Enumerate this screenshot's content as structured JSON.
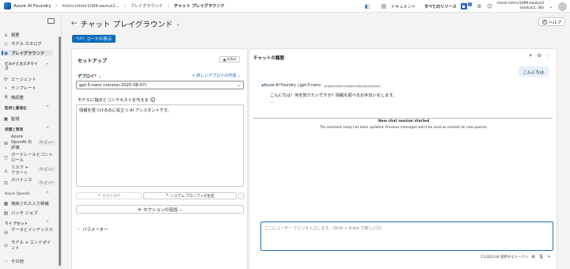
{
  "topbar": {
    "brand": "Azure AI Foundry",
    "breadcrumbs": [
      "moris-mhmr1h89-eastus2",
      "プレイグラウンド",
      "チャット プレイグラウンド"
    ],
    "docs": "ドキュメント",
    "all_resources": "すべてのリソース",
    "notif_badge": "2",
    "user_line1": "moris-mhmr1h89-eastus2",
    "user_line2": "(eastus2, 3B)"
  },
  "sidebar": {
    "items_top": [
      "概要",
      "モデル カタログ",
      "プレイグラウンド"
    ],
    "section_build": "ビルドとカスタマイズ",
    "build_items": [
      "エージェント",
      "テンプレート",
      "微調整"
    ],
    "section_observe": "監視と最適化",
    "observe_items": [
      "監視"
    ],
    "section_protect": "保護と管理",
    "protect_items": [
      {
        "label": "Azure OpenAI の評価",
        "tag": "プレビュー"
      },
      {
        "label": "ガードレールとコントロール",
        "tag": ""
      },
      {
        "label": "リスク + アラート",
        "tag": "プレビュー"
      },
      {
        "label": "ガバナンス",
        "tag": "プレビュー"
      }
    ],
    "section_aoai": "Azure OpenAI",
    "aoai_items": [
      "格納された入力候補",
      "バッチ ジョブ"
    ],
    "section_assets": "マイ アセット",
    "asset_items": [
      "データとインデックス",
      "モデル + エンドポイント"
    ],
    "more": "その他"
  },
  "main": {
    "title": "チャット プレイグラウンド",
    "help": "ヘルプ",
    "code_button": "コードの表示"
  },
  "setup": {
    "title": "セットアップ",
    "hide": "非表示",
    "deploy_label": "デプロイ",
    "new_deploy": "新しいデプロイの作成",
    "deployment": "gpt-5-nano (version:2025-08-07)",
    "instr_label": "モデルに指示とコンテキストを与える",
    "instructions": "情報を見つけるのに役立つ AI アシスタントです。",
    "apply_changes": "変更の適用",
    "gen_prompt": "システム プロンプトの生成",
    "add_section": "セクションの追加",
    "parameters": "パラメーター"
  },
  "chat": {
    "title": "チャットの履歴",
    "user_message": "こんにちは",
    "assistant_name": "Azure AI Foundry | gpt-5-nano",
    "ai_tag": "AI-generated content may be incorrect",
    "assistant_message": "こんにちは！何を知りたいですか？情報を調べるお手伝いをします。",
    "ellipsis": "...",
    "session_started": "New chat session started",
    "session_note": "The assistant setup has been updated. Previous messages won't be used as context for new queries.",
    "input_placeholder": "ここにユーザー クエリを入力します。(Shift + Enter で新しい行)",
    "token_count": "21/262144 使用するトークン"
  }
}
